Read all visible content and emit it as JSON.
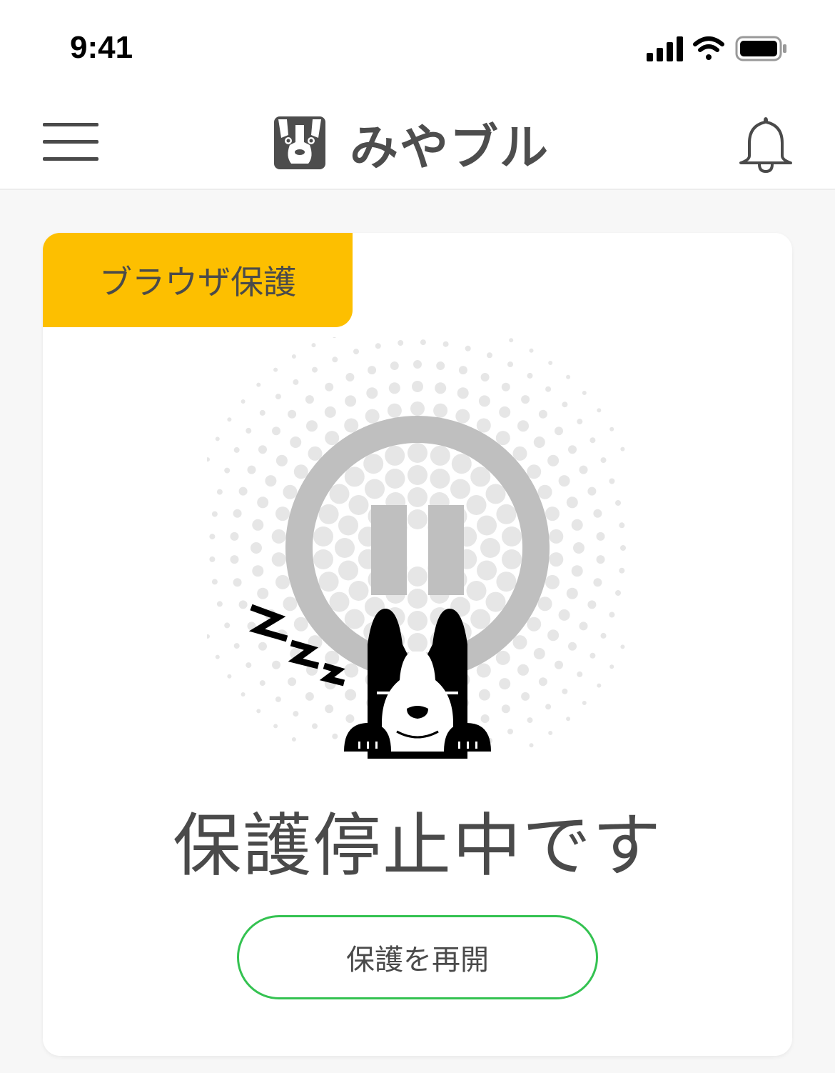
{
  "status_bar": {
    "time": "9:41"
  },
  "header": {
    "app_name": "みやブル",
    "menu_icon": "hamburger-menu-icon",
    "notification_icon": "bell-icon"
  },
  "card": {
    "tag_label": "ブラウザ保護",
    "status_text": "保護停止中です",
    "resume_button_label": "保護を再開",
    "illustration": "sleeping-dog-pause-icon"
  },
  "colors": {
    "tag_background": "#fdbf00",
    "button_border": "#34c251",
    "pause_gray": "#bfbfbf"
  }
}
